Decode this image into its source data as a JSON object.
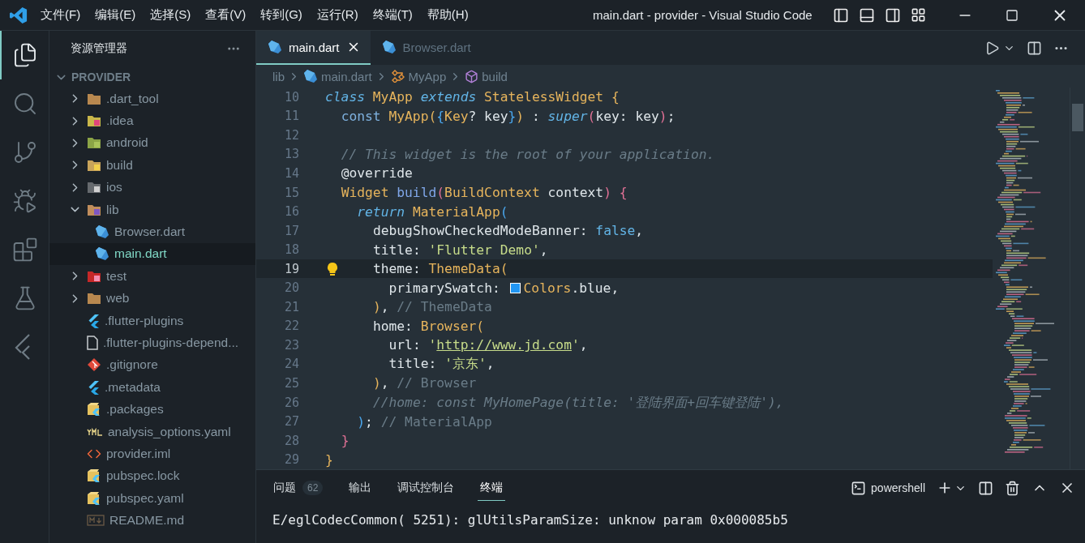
{
  "title_bar": {
    "menu": [
      "文件(F)",
      "编辑(E)",
      "选择(S)",
      "查看(V)",
      "转到(G)",
      "运行(R)",
      "终端(T)",
      "帮助(H)"
    ],
    "title": "main.dart - provider - Visual Studio Code"
  },
  "activity_bar": [
    {
      "kind": "explorer",
      "selected": true
    },
    {
      "kind": "search",
      "selected": false
    },
    {
      "kind": "source-control",
      "selected": false
    },
    {
      "kind": "debug",
      "selected": false
    },
    {
      "kind": "extensions",
      "selected": false
    },
    {
      "kind": "testing",
      "selected": false
    },
    {
      "kind": "flutter",
      "selected": false
    }
  ],
  "sidebar": {
    "title": "资源管理器",
    "section": "PROVIDER",
    "section_expanded": true,
    "tree": [
      {
        "label": ".dart_tool",
        "kind": "folder",
        "expanded": false,
        "selected": false
      },
      {
        "label": ".idea",
        "kind": "folder-idea",
        "expanded": false,
        "selected": false
      },
      {
        "label": "android",
        "kind": "folder-android",
        "expanded": false,
        "selected": false
      },
      {
        "label": "build",
        "kind": "folder-build",
        "expanded": false,
        "selected": false
      },
      {
        "label": "ios",
        "kind": "folder-ios",
        "expanded": false,
        "selected": false
      },
      {
        "label": "lib",
        "kind": "folder-lib",
        "expanded": true,
        "selected": false,
        "children": [
          {
            "label": "Browser.dart",
            "kind": "dart",
            "selected": false
          },
          {
            "label": "main.dart",
            "kind": "dart",
            "selected": true
          }
        ]
      },
      {
        "label": "test",
        "kind": "folder-test",
        "expanded": false,
        "selected": false
      },
      {
        "label": "web",
        "kind": "folder",
        "expanded": false,
        "selected": false
      },
      {
        "label": ".flutter-plugins",
        "kind": "flutter",
        "selected": false
      },
      {
        "label": ".flutter-plugins-depend...",
        "kind": "file",
        "selected": false
      },
      {
        "label": ".gitignore",
        "kind": "git",
        "selected": false
      },
      {
        "label": ".metadata",
        "kind": "flutter",
        "selected": false
      },
      {
        "label": ".packages",
        "kind": "packages",
        "selected": false
      },
      {
        "label": "analysis_options.yaml",
        "kind": "yaml",
        "selected": false
      },
      {
        "label": "provider.iml",
        "kind": "xml",
        "selected": false
      },
      {
        "label": "pubspec.lock",
        "kind": "packages",
        "selected": false
      },
      {
        "label": "pubspec.yaml",
        "kind": "packages",
        "selected": false
      },
      {
        "label": "README.md",
        "kind": "markdown",
        "selected": false
      }
    ]
  },
  "tabs": [
    {
      "label": "main.dart",
      "selected": true
    },
    {
      "label": "Browser.dart",
      "selected": false
    }
  ],
  "breadcrumb": [
    {
      "label": "lib",
      "kind": "folder"
    },
    {
      "label": "main.dart",
      "kind": "dart"
    },
    {
      "label": "MyApp",
      "kind": "class"
    },
    {
      "label": "build",
      "kind": "method"
    }
  ],
  "editor": {
    "lines": [
      {
        "number": "10",
        "current": false,
        "tokens": [
          {
            "text": "class",
            "kind": "kw"
          },
          {
            "text": " MyApp ",
            "kind": "type"
          },
          {
            "text": "extends",
            "kind": "kw"
          },
          {
            "text": " StatelessWidget {",
            "kind": "type"
          }
        ]
      },
      {
        "number": "11",
        "current": false,
        "tokens": [
          {
            "text": "  const",
            "kind": "const"
          },
          {
            "text": " MyApp(",
            "kind": "type"
          },
          {
            "text": "{",
            "kind": "bb"
          },
          {
            "text": "Key",
            "kind": "type"
          },
          {
            "text": "? key",
            "kind": "plain"
          },
          {
            "text": "}",
            "kind": "bb"
          },
          {
            "text": ")",
            "kind": "bo"
          },
          {
            "text": " : ",
            "kind": "plain"
          },
          {
            "text": "super",
            "kind": "kw"
          },
          {
            "text": "(",
            "kind": "bp"
          },
          {
            "text": "key: key",
            "kind": "plain"
          },
          {
            "text": ")",
            "kind": "bp"
          },
          {
            "text": ";",
            "kind": "plain"
          }
        ]
      },
      {
        "number": "12",
        "current": false
      },
      {
        "number": "13",
        "current": false,
        "tokens": [
          {
            "text": "  // This widget is the root of your application.",
            "kind": "cmt"
          }
        ]
      },
      {
        "number": "14",
        "current": false,
        "tokens": [
          {
            "text": "  @override",
            "kind": "plain"
          }
        ]
      },
      {
        "number": "15",
        "current": false,
        "tokens": [
          {
            "text": "  Widget ",
            "kind": "type"
          },
          {
            "text": "build",
            "kind": "fn"
          },
          {
            "text": "(",
            "kind": "bp"
          },
          {
            "text": "BuildContext",
            "kind": "type"
          },
          {
            "text": " context",
            "kind": "plain"
          },
          {
            "text": ") {",
            "kind": "bp"
          }
        ]
      },
      {
        "number": "16",
        "current": false,
        "tokens": [
          {
            "text": "    return",
            "kind": "kw"
          },
          {
            "text": " MaterialApp",
            "kind": "type"
          },
          {
            "text": "(",
            "kind": "bb"
          }
        ]
      },
      {
        "number": "17",
        "current": false,
        "tokens": [
          {
            "text": "      debugShowCheckedModeBanner: ",
            "kind": "plain"
          },
          {
            "text": "false",
            "kind": "lit"
          },
          {
            "text": ",",
            "kind": "plain"
          }
        ]
      },
      {
        "number": "18",
        "current": false,
        "tokens": [
          {
            "text": "      title: ",
            "kind": "plain"
          },
          {
            "text": "'Flutter Demo'",
            "kind": "str"
          },
          {
            "text": ",",
            "kind": "plain"
          }
        ]
      },
      {
        "number": "19",
        "current": true,
        "tokens": [
          {
            "text": "      theme: ",
            "kind": "plain"
          },
          {
            "text": "ThemeData(",
            "kind": "type"
          }
        ]
      },
      {
        "number": "20",
        "current": false,
        "tokens": [
          {
            "text": "        primarySwatch: ",
            "kind": "plain"
          },
          {
            "kind": "swatch",
            "color": "#2196f3"
          },
          {
            "text": "Colors",
            "kind": "type"
          },
          {
            "text": ".blue,",
            "kind": "plain"
          }
        ]
      },
      {
        "number": "21",
        "current": false,
        "tokens": [
          {
            "text": "      )",
            "kind": "bo"
          },
          {
            "text": ", ",
            "kind": "plain"
          },
          {
            "text": "// ThemeData",
            "kind": "cmt2"
          }
        ]
      },
      {
        "number": "22",
        "current": false,
        "tokens": [
          {
            "text": "      home: ",
            "kind": "plain"
          },
          {
            "text": "Browser(",
            "kind": "type"
          }
        ]
      },
      {
        "number": "23",
        "current": false,
        "tokens": [
          {
            "text": "        url: ",
            "kind": "plain"
          },
          {
            "text": "'",
            "kind": "str"
          },
          {
            "text": "http://www.jd.com",
            "kind": "link"
          },
          {
            "text": "'",
            "kind": "str"
          },
          {
            "text": ",",
            "kind": "plain"
          }
        ]
      },
      {
        "number": "24",
        "current": false,
        "tokens": [
          {
            "text": "        title: ",
            "kind": "plain"
          },
          {
            "text": "'京东'",
            "kind": "str"
          },
          {
            "text": ",",
            "kind": "plain"
          }
        ]
      },
      {
        "number": "25",
        "current": false,
        "tokens": [
          {
            "text": "      )",
            "kind": "bo"
          },
          {
            "text": ", ",
            "kind": "plain"
          },
          {
            "text": "// Browser",
            "kind": "cmt2"
          }
        ]
      },
      {
        "number": "26",
        "current": false,
        "tokens": [
          {
            "text": "      //home: const MyHomePage(title: '登陆界面+回车键登陆'),",
            "kind": "cmt"
          }
        ]
      },
      {
        "number": "27",
        "current": false,
        "tokens": [
          {
            "text": "    )",
            "kind": "bb"
          },
          {
            "text": "; ",
            "kind": "plain"
          },
          {
            "text": "// MaterialApp",
            "kind": "cmt2"
          }
        ]
      },
      {
        "number": "28",
        "current": false,
        "tokens": [
          {
            "text": "  }",
            "kind": "bp"
          }
        ]
      },
      {
        "number": "29",
        "current": false,
        "tokens": [
          {
            "text": "}",
            "kind": "bo"
          }
        ]
      }
    ]
  },
  "panel": {
    "tabs": [
      {
        "label": "问题",
        "badge": "62",
        "selected": false
      },
      {
        "label": "输出",
        "selected": false
      },
      {
        "label": "调试控制台",
        "selected": false
      },
      {
        "label": "终端",
        "selected": true
      }
    ],
    "terminal_name": "powershell",
    "output": [
      "E/eglCodecCommon( 5251): glUtilsParamSize: unknow param 0x000085b5"
    ]
  }
}
